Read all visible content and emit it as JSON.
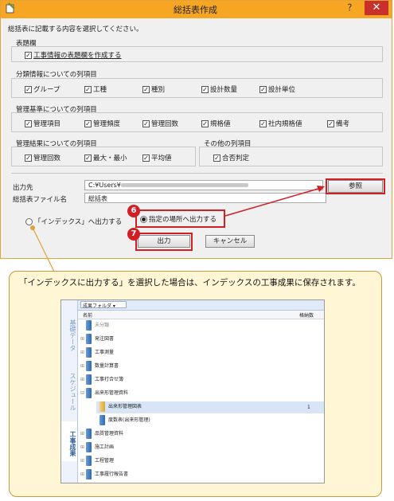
{
  "dialog": {
    "title": "総括表作成",
    "close": "✕",
    "minimize": "？",
    "instruction": "総括表に記載する内容を選択してください。",
    "sections": {
      "hyodai": {
        "title": "表題欄",
        "items": [
          {
            "label": "工事情報の表題欄を作成する",
            "checked": true
          }
        ]
      },
      "bunrui": {
        "title": "分類情報についての列項目",
        "items": [
          {
            "label": "グループ",
            "checked": true
          },
          {
            "label": "工種",
            "checked": true
          },
          {
            "label": "種別",
            "checked": true
          },
          {
            "label": "設計数量",
            "checked": true
          },
          {
            "label": "設計単位",
            "checked": true
          }
        ]
      },
      "kanri": {
        "title": "管理基準についての列項目",
        "items": [
          {
            "label": "管理項目",
            "checked": true
          },
          {
            "label": "管理頻度",
            "checked": true
          },
          {
            "label": "管理回数",
            "checked": true
          },
          {
            "label": "規格値",
            "checked": true
          },
          {
            "label": "社内規格値",
            "checked": true
          },
          {
            "label": "備考",
            "checked": true
          }
        ]
      },
      "kekka": {
        "title": "管理結果についての列項目",
        "items": [
          {
            "label": "管理回数",
            "checked": true
          },
          {
            "label": "最大・最小",
            "checked": true
          },
          {
            "label": "平均値",
            "checked": true
          }
        ]
      },
      "sonota": {
        "title": "その他の列項目",
        "items": [
          {
            "label": "合否判定",
            "checked": true
          }
        ]
      }
    },
    "output_dest_label": "出力先",
    "output_dest_value": "C:¥Users¥",
    "file_name_label": "総括表ファイル名",
    "file_name_value": "総括表",
    "browse_button": "参照",
    "radio_index": "「インデックス」へ出力する",
    "radio_folder": "指定の場所へ出力する",
    "output_button": "出力",
    "cancel_button": "キャンセル",
    "badge_6": "6",
    "badge_7": "7"
  },
  "note": {
    "text": "「インデックスに出力する」を選択した場合は、インデックスの工事成果に保存されます。"
  },
  "inset": {
    "dropdown": "成果フォルダ",
    "col_name": "名前",
    "col_count": "格納数",
    "tabs": [
      "基礎データ",
      "スケジュール",
      "工事成果"
    ],
    "rows": [
      {
        "label": "未分類",
        "indent": 0,
        "count": ""
      },
      {
        "label": "発注図書",
        "indent": 0,
        "count": ""
      },
      {
        "label": "工事測量",
        "indent": 0,
        "count": ""
      },
      {
        "label": "数量計算書",
        "indent": 0,
        "count": ""
      },
      {
        "label": "工事打合せ簿",
        "indent": 0,
        "count": ""
      },
      {
        "label": "出来形管理資料",
        "indent": 0,
        "count": ""
      },
      {
        "label": "出来形管理図表",
        "indent": 1,
        "count": "1"
      },
      {
        "label": "度数表(出来形管理)",
        "indent": 1,
        "count": ""
      },
      {
        "label": "品質管理資料",
        "indent": 0,
        "count": ""
      },
      {
        "label": "施工計画",
        "indent": 0,
        "count": ""
      },
      {
        "label": "工程管理",
        "indent": 0,
        "count": ""
      },
      {
        "label": "工事履行報告書",
        "indent": 0,
        "count": ""
      }
    ]
  }
}
